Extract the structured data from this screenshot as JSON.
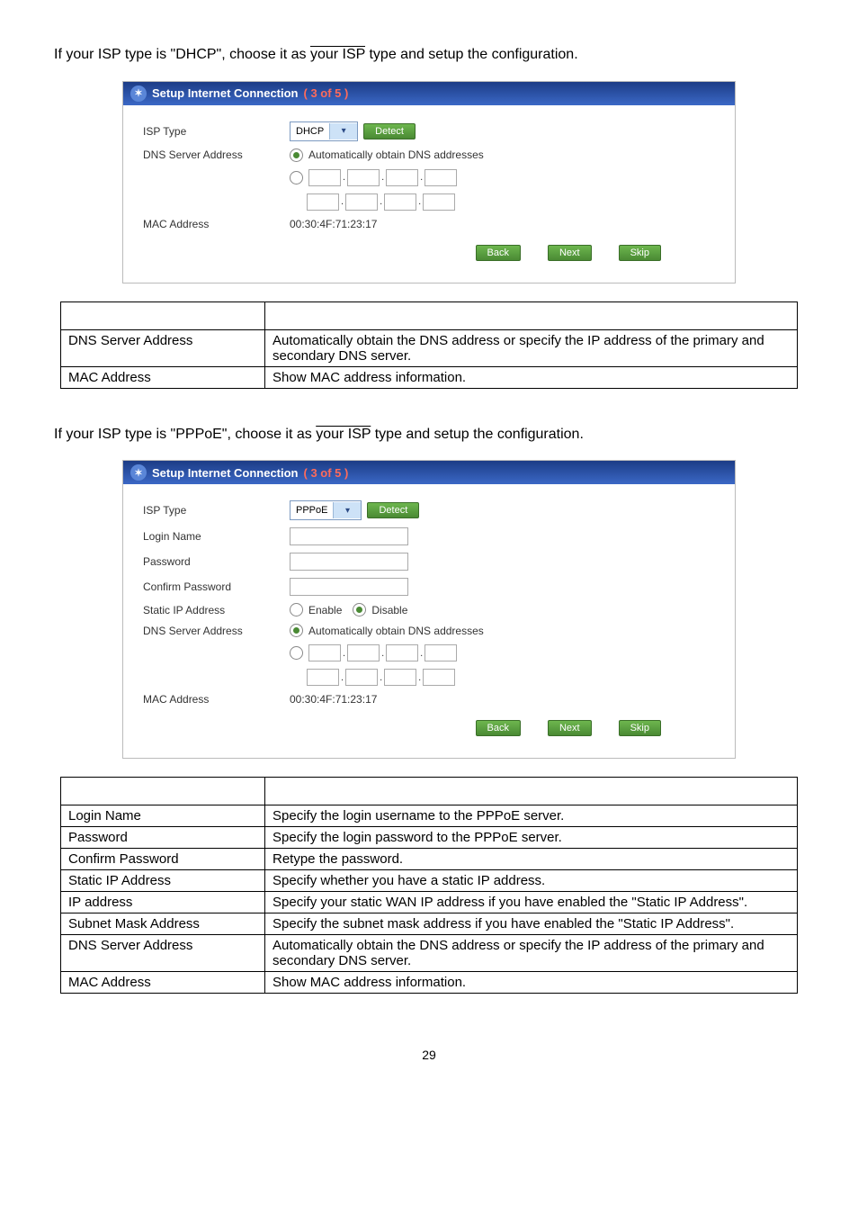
{
  "para1_pre": "If your ISP type is \"DHCP\", choose it as ",
  "para1_over": "your ISP",
  "para1_post": " type and setup the configuration.",
  "para2_pre": "If your ISP type is \"PPPoE\", choose it as ",
  "para2_over": "your ISP",
  "para2_post": " type and setup the configuration.",
  "wizard": {
    "title_pre": "Setup Internet Connection ",
    "title_step": "( 3 of 5 )",
    "detect": "Detect",
    "back": "Back",
    "next": "Next",
    "skip": "Skip",
    "dhcp": {
      "isp_type_label": "ISP Type",
      "isp_type_value": "DHCP",
      "dns_label": "DNS Server Address",
      "dns_auto": "Automatically obtain DNS addresses",
      "mac_label": "MAC Address",
      "mac_value": "00:30:4F:71:23:17"
    },
    "pppoe": {
      "isp_type_label": "ISP Type",
      "isp_type_value": "PPPoE",
      "login_label": "Login Name",
      "password_label": "Password",
      "confirm_label": "Confirm Password",
      "static_label": "Static IP Address",
      "enable": "Enable",
      "disable": "Disable",
      "dns_label": "DNS Server Address",
      "dns_auto": "Automatically obtain DNS addresses",
      "mac_label": "MAC Address",
      "mac_value": "00:30:4F:71:23:17"
    }
  },
  "table1": {
    "r1c1": "DNS Server Address",
    "r1c2": "Automatically obtain the DNS address or specify the IP address of the primary and secondary DNS server.",
    "r2c1": "MAC Address",
    "r2c2": "Show MAC address information."
  },
  "table2": {
    "r1c1": "Login Name",
    "r1c2": "Specify the login username to the PPPoE server.",
    "r2c1": "Password",
    "r2c2": "Specify the login password to the PPPoE server.",
    "r3c1": "Confirm Password",
    "r3c2": "Retype the password.",
    "r4c1": "Static IP Address",
    "r4c2": "Specify whether you have a static IP address.",
    "r5c1": "IP address",
    "r5c2": "Specify your static WAN IP address if you have enabled the \"Static IP Address\".",
    "r6c1": "Subnet Mask Address",
    "r6c2": "Specify the subnet mask address if you have enabled the \"Static IP Address\".",
    "r7c1": "DNS Server Address",
    "r7c2": "Automatically obtain the DNS address or specify the IP address of the primary and secondary DNS server.",
    "r8c1": "MAC Address",
    "r8c2": "Show MAC address information."
  },
  "page_number": "29"
}
